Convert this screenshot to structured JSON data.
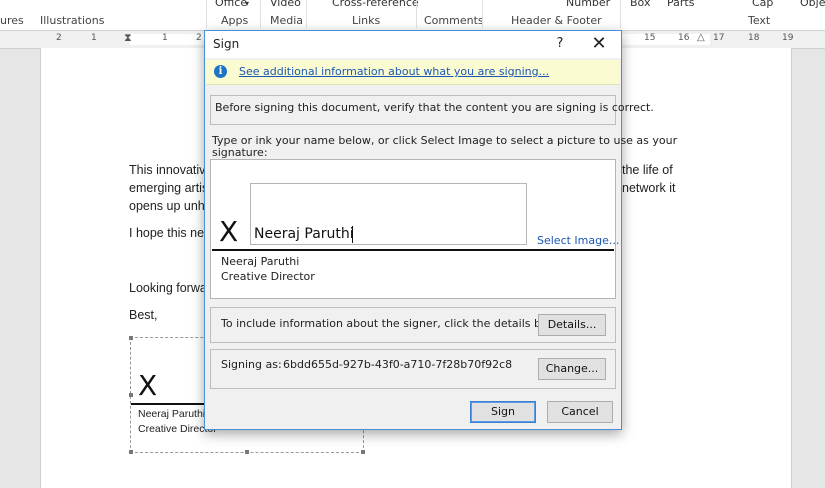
{
  "ribbon": {
    "top_items": [
      "Office",
      "Video",
      "Cross-reference",
      "Number",
      "Box",
      "Parts",
      "Cap",
      "Obje"
    ],
    "groups": [
      "ures",
      "Illustrations",
      "Apps",
      "Media",
      "Links",
      "Comments",
      "Header & Footer",
      "Text"
    ]
  },
  "ruler": {
    "left_numbers": [
      "2",
      "1",
      "1",
      "2"
    ],
    "right_numbers": [
      "15",
      "16",
      "17",
      "18",
      "19"
    ]
  },
  "document": {
    "line1_left": "This innovativ",
    "line1_right": "the life of",
    "line2_left": "emerging artis",
    "line2_right": "network it",
    "line3_left": "opens up unh",
    "line4_left": "I hope this ne",
    "line5_left": "Looking forwa",
    "line6_left": "Best,",
    "sig_x": "X",
    "sig_name": "Neeraj Paruthi",
    "sig_title": "Creative Director"
  },
  "dialog": {
    "title": "Sign",
    "help_label": "?",
    "close_label": "✕",
    "info_link": "See additional information about what you are signing...",
    "verify_text": "Before signing this document, verify that the content you are signing is correct.",
    "instruction_line1": "Type or ink your name below, or click Select Image to select a picture to use as your",
    "instruction_line2": "signature:",
    "sig_x": "X",
    "sig_value": "Neeraj Paruthi",
    "select_image": "Select Image...",
    "signer_name": "Neeraj Paruthi",
    "signer_title": "Creative Director",
    "details_text": "To include information about the signer, click the details button.",
    "details_button": "Details...",
    "signing_as_label": "Signing as:",
    "signing_as_value": "6bdd655d-927b-43f0-a710-7f28b70f92c8",
    "change_button": "Change...",
    "sign_button": "Sign",
    "cancel_button": "Cancel"
  }
}
